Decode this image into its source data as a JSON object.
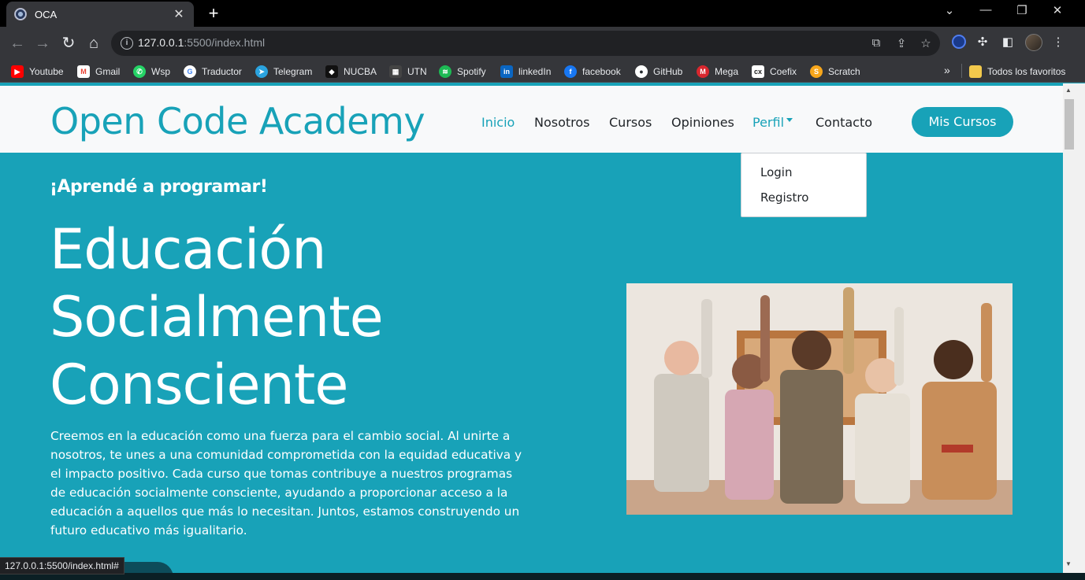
{
  "browser": {
    "tab_title": "OCA",
    "url_host": "127.0.0.1",
    "url_rest": ":5500/index.html",
    "status_url": "127.0.0.1:5500/index.html#"
  },
  "bookmarks": [
    {
      "label": "Youtube",
      "icon": "youtube-icon",
      "color": "#ff0000"
    },
    {
      "label": "Gmail",
      "icon": "gmail-icon",
      "color": "#ea4335"
    },
    {
      "label": "Wsp",
      "icon": "whatsapp-icon",
      "color": "#25d366"
    },
    {
      "label": "Traductor",
      "icon": "google-icon",
      "color": "#4285f4"
    },
    {
      "label": "Telegram",
      "icon": "telegram-icon",
      "color": "#2aa3df"
    },
    {
      "label": "NUCBA",
      "icon": "nucba-icon",
      "color": "#111111"
    },
    {
      "label": "UTN",
      "icon": "utn-icon",
      "color": "#444444"
    },
    {
      "label": "Spotify",
      "icon": "spotify-icon",
      "color": "#1db954"
    },
    {
      "label": "linkedIn",
      "icon": "linkedin-icon",
      "color": "#0a66c2"
    },
    {
      "label": "facebook",
      "icon": "facebook-icon",
      "color": "#1877f2"
    },
    {
      "label": "GitHub",
      "icon": "github-icon",
      "color": "#24292e"
    },
    {
      "label": "Mega",
      "icon": "mega-icon",
      "color": "#d9272e"
    },
    {
      "label": "Coefix",
      "icon": "coefix-icon",
      "color": "#222222"
    },
    {
      "label": "Scratch",
      "icon": "scratch-icon",
      "color": "#f7a61b"
    }
  ],
  "bookmarks_folder": "Todos los favoritos",
  "site": {
    "brand": "Open Code Academy",
    "nav": {
      "inicio": "Inicio",
      "nosotros": "Nosotros",
      "cursos": "Cursos",
      "opiniones": "Opiniones",
      "perfil": "Perfil",
      "contacto": "Contacto"
    },
    "cta": "Mis Cursos",
    "dropdown": {
      "login": "Login",
      "registro": "Registro"
    },
    "kicker": "¡Aprendé a programar!",
    "headline": [
      "Educación",
      "Socialmente",
      "Consciente"
    ],
    "lead": "Creemos en la educación como una fuerza para el cambio social. Al unirte a nosotros, te unes a una comunidad comprometida con la equidad educativa y el impacto positivo. Cada curso que tomas contribuye a nuestros programas de educación socialmente consciente, ayudando a proporcionar acceso a la educación a aquellos que más lo necesitan. Juntos, estamos construyendo un futuro educativo más igualitario.",
    "accent_color": "#18a2b8"
  }
}
